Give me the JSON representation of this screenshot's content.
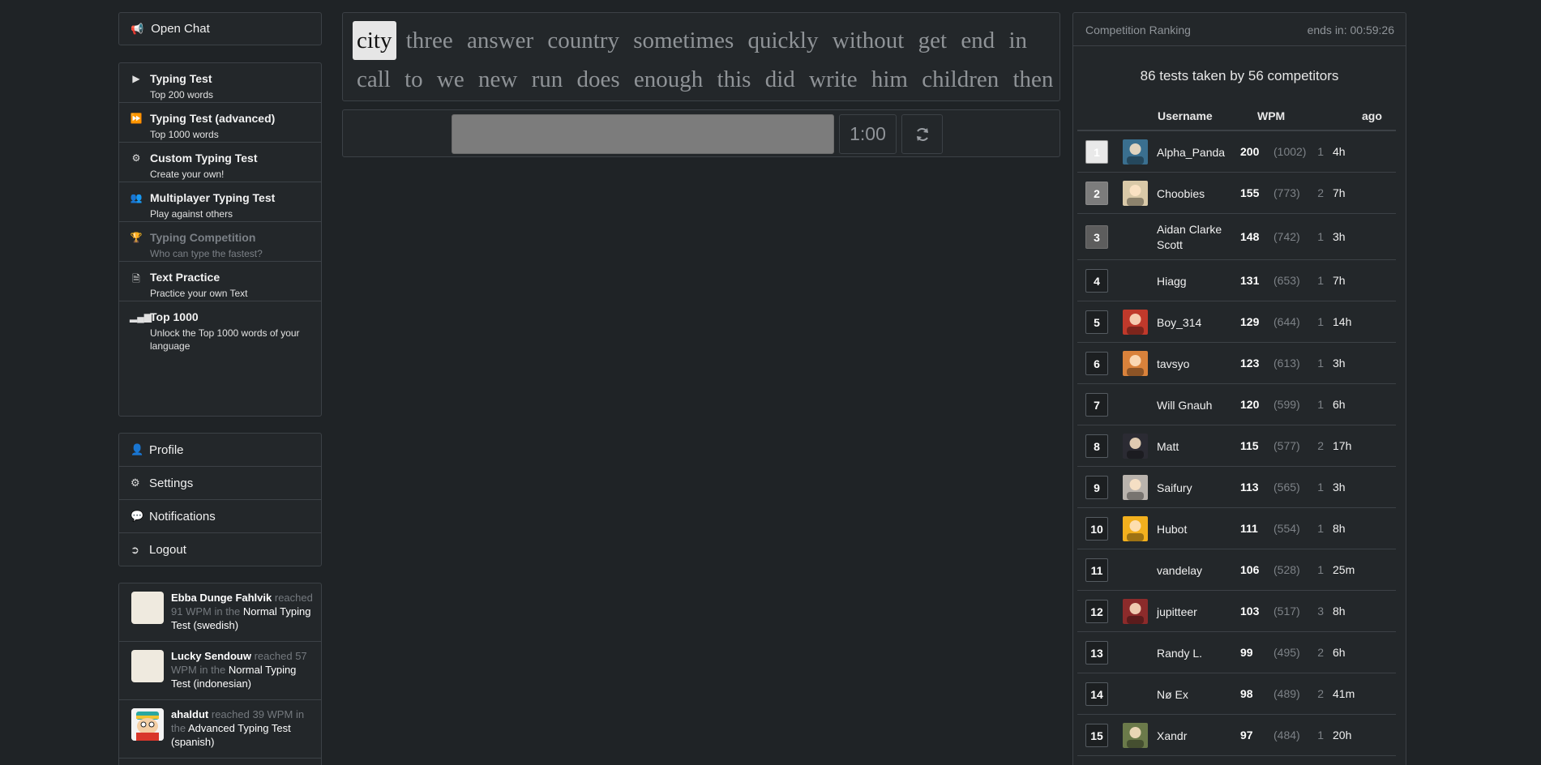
{
  "sidebar": {
    "open_chat": "Open Chat",
    "nav": [
      {
        "title": "Typing Test",
        "sub": "Top 200 words",
        "icon": "play-icon",
        "disabled": false
      },
      {
        "title": "Typing Test (advanced)",
        "sub": "Top 1000 words",
        "icon": "fast-forward-icon",
        "disabled": false
      },
      {
        "title": "Custom Typing Test",
        "sub": "Create your own!",
        "icon": "cogs-icon",
        "disabled": false
      },
      {
        "title": "Multiplayer Typing Test",
        "sub": "Play against others",
        "icon": "users-icon",
        "disabled": false
      },
      {
        "title": "Typing Competition",
        "sub": "Who can type the fastest?",
        "icon": "trophy-icon",
        "disabled": true
      },
      {
        "title": "Text Practice",
        "sub": "Practice your own Text",
        "icon": "document-icon",
        "disabled": false
      },
      {
        "title": "Top 1000",
        "sub": "Unlock the Top 1000 words of your language",
        "icon": "signal-bars-icon",
        "disabled": false
      }
    ],
    "account": [
      {
        "label": "Profile",
        "icon": "user-icon"
      },
      {
        "label": "Settings",
        "icon": "gear-icon"
      },
      {
        "label": "Notifications",
        "icon": "comment-icon"
      },
      {
        "label": "Logout",
        "icon": "logout-icon"
      }
    ],
    "feed": [
      {
        "user": "Ebba Dunge Fahlvik",
        "reached": "reached",
        "wpm": "91 WPM",
        "in_the": "in the",
        "test": "Normal Typing Test (swedish)"
      },
      {
        "user": "Lucky Sendouw",
        "reached": "reached",
        "wpm": "57 WPM",
        "in_the": "in the",
        "test": "Normal Typing Test (indonesian)"
      },
      {
        "user": "ahaldut",
        "reached": "reached",
        "wpm": "39 WPM",
        "in_the": "in the",
        "test": "Advanced Typing Test (spanish)"
      }
    ]
  },
  "test": {
    "words": [
      "city",
      "three",
      "answer",
      "country",
      "sometimes",
      "quickly",
      "without",
      "get",
      "end",
      "in",
      "call",
      "to",
      "we",
      "new",
      "run",
      "does",
      "enough",
      "this",
      "did",
      "write",
      "him",
      "children",
      "then"
    ],
    "active_index": 0,
    "input_value": "",
    "timer": "1:00"
  },
  "ranking": {
    "title": "Competition Ranking",
    "ends": "ends in: 00:59:26",
    "summary": "86 tests taken by 56 competitors",
    "headers": {
      "username": "Username",
      "wpm": "WPM",
      "ago": "ago"
    },
    "rows": [
      {
        "rank": "1",
        "user": "Alpha_Panda",
        "wpm": "200",
        "kps": "(1002)",
        "tries": "1",
        "ago": "4h",
        "avatar": true,
        "color": "#3a6f8f"
      },
      {
        "rank": "2",
        "user": "Choobies",
        "wpm": "155",
        "kps": "(773)",
        "tries": "2",
        "ago": "7h",
        "avatar": true,
        "color": "#d9c9a8"
      },
      {
        "rank": "3",
        "user": "Aidan Clarke Scott",
        "wpm": "148",
        "kps": "(742)",
        "tries": "1",
        "ago": "3h",
        "avatar": false,
        "color": ""
      },
      {
        "rank": "4",
        "user": "Hiagg",
        "wpm": "131",
        "kps": "(653)",
        "tries": "1",
        "ago": "7h",
        "avatar": false,
        "color": ""
      },
      {
        "rank": "5",
        "user": "Boy_314",
        "wpm": "129",
        "kps": "(644)",
        "tries": "1",
        "ago": "14h",
        "avatar": true,
        "color": "#c0392b"
      },
      {
        "rank": "6",
        "user": "tavsyo",
        "wpm": "123",
        "kps": "(613)",
        "tries": "1",
        "ago": "3h",
        "avatar": true,
        "color": "#d9823b"
      },
      {
        "rank": "7",
        "user": "Will Gnauh",
        "wpm": "120",
        "kps": "(599)",
        "tries": "1",
        "ago": "6h",
        "avatar": false,
        "color": ""
      },
      {
        "rank": "8",
        "user": "Matt",
        "wpm": "115",
        "kps": "(577)",
        "tries": "2",
        "ago": "17h",
        "avatar": true,
        "color": "#2b2b33"
      },
      {
        "rank": "9",
        "user": "Saifury",
        "wpm": "113",
        "kps": "(565)",
        "tries": "1",
        "ago": "3h",
        "avatar": true,
        "color": "#b9b3ad"
      },
      {
        "rank": "10",
        "user": "Hubot",
        "wpm": "111",
        "kps": "(554)",
        "tries": "1",
        "ago": "8h",
        "avatar": true,
        "color": "#f2b01e"
      },
      {
        "rank": "11",
        "user": "vandelay",
        "wpm": "106",
        "kps": "(528)",
        "tries": "1",
        "ago": "25m",
        "avatar": false,
        "color": ""
      },
      {
        "rank": "12",
        "user": "jupitteer",
        "wpm": "103",
        "kps": "(517)",
        "tries": "3",
        "ago": "8h",
        "avatar": true,
        "color": "#8c2b2b"
      },
      {
        "rank": "13",
        "user": "Randy L.",
        "wpm": "99",
        "kps": "(495)",
        "tries": "2",
        "ago": "6h",
        "avatar": false,
        "color": ""
      },
      {
        "rank": "14",
        "user": "Nø Ex",
        "wpm": "98",
        "kps": "(489)",
        "tries": "2",
        "ago": "41m",
        "avatar": false,
        "color": ""
      },
      {
        "rank": "15",
        "user": "Xandr",
        "wpm": "97",
        "kps": "(484)",
        "tries": "1",
        "ago": "20h",
        "avatar": true,
        "color": "#6b7a4a"
      }
    ]
  }
}
